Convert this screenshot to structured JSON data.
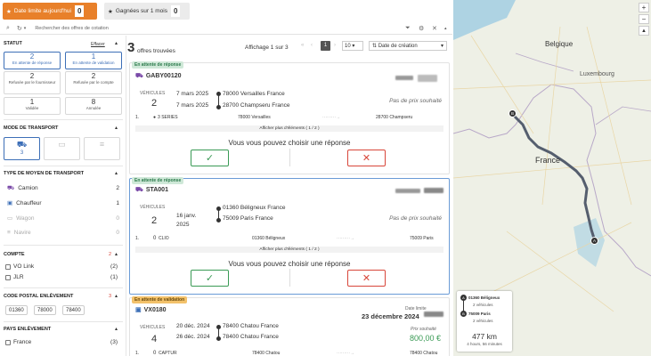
{
  "top_filters": [
    {
      "label": "Date limite aujourd'hui",
      "count": "0",
      "color": "#e8802a"
    },
    {
      "label": "Gagnées sur 1 mois",
      "count": "0",
      "color": "#ebebeb"
    }
  ],
  "search": {
    "placeholder": "Rechercher des offres de cotation"
  },
  "results": {
    "count": "3",
    "label": "offres trouvées",
    "display": "Affichage 1 sur 3",
    "page": "1",
    "per_page": "10",
    "sort": "Date de création"
  },
  "sidebar": {
    "statut": {
      "title": "STATUT",
      "clear": "Effacer",
      "items": [
        {
          "n": "2",
          "label": "En attente de réponse"
        },
        {
          "n": "1",
          "label": "En attente de validation"
        },
        {
          "n": "2",
          "label": "Refusée par le fournisseur"
        },
        {
          "n": "2",
          "label": "Refusée par le compte"
        },
        {
          "n": "1",
          "label": "Validée"
        },
        {
          "n": "8",
          "label": "Annulée"
        }
      ]
    },
    "mode": {
      "title": "MODE DE TRANSPORT",
      "items": [
        {
          "count": "3"
        },
        {
          "count": ""
        },
        {
          "count": ""
        }
      ]
    },
    "moyen": {
      "title": "TYPE DE MOYEN DE TRANSPORT",
      "items": [
        {
          "label": "Camion",
          "count": "2"
        },
        {
          "label": "Chauffeur",
          "count": "1"
        },
        {
          "label": "Wagon",
          "count": "0"
        },
        {
          "label": "Navire",
          "count": "0"
        }
      ]
    },
    "compte": {
      "title": "COMPTE",
      "badge": "2",
      "items": [
        {
          "label": "VO Link",
          "count": "(2)"
        },
        {
          "label": "JLR",
          "count": "(1)"
        }
      ]
    },
    "cp": {
      "title": "CODE POSTAL ENLÈVEMENT",
      "badge": "3",
      "tags": [
        "01360",
        "78000",
        "78400"
      ]
    },
    "pays": {
      "title": "PAYS ENLÈVEMENT",
      "items": [
        {
          "label": "France",
          "count": "(3)"
        }
      ]
    }
  },
  "cards": [
    {
      "badge": "En attente de réponse",
      "ref": "GABY00120",
      "veh_label": "VÉHICULES",
      "veh": "2",
      "date1": "7 mars 2025",
      "date2": "7 mars 2025",
      "from": "78000 Versailles France",
      "to": "28700 Champseru France",
      "price": "Pas de prix souhaité",
      "line_n": "1.",
      "line_model": "3 SERIES",
      "line_from": "78000 Versailles",
      "line_to": "28700 Champseru",
      "more": "Afficher plus d'éléments ( 1 / 2 )",
      "choose": "Vous vous pouvez choisir une réponse"
    },
    {
      "badge": "En attente de réponse",
      "ref": "STA001",
      "veh_label": "VÉHICULES",
      "veh": "2",
      "date1": "16 janv.",
      "date1b": "2025",
      "from": "01360 Béligneux France",
      "to": "75009 Paris France",
      "price": "Pas de prix souhaité",
      "line_n": "1.",
      "line_qty": "0",
      "line_model": "CLIO",
      "line_from": "01360 Béligneux",
      "line_to": "75009 Paris",
      "more": "Afficher plus d'éléments ( 1 / 2 )",
      "choose": "Vous vous pouvez choisir une réponse"
    },
    {
      "badge": "En attente de validation",
      "ref": "VX0180",
      "veh_label": "VÉHICULES",
      "veh": "4",
      "date1": "20 déc. 2024",
      "date2": "26 déc. 2024",
      "from": "78400 Chatou France",
      "to": "78400 Chatou France",
      "deadline_label": "Date limite",
      "deadline": "23 décembre 2024",
      "price_label": "Prix souhaité",
      "price": "800,00 €",
      "line_n": "1.",
      "line_qty": "0",
      "line_model": "CAPTUR",
      "line_from": "78400 Chatou",
      "line_to": "78400 Chatou"
    }
  ],
  "map": {
    "labels": {
      "belgique": "Belgique",
      "luxembourg": "Luxembourg",
      "france": "France"
    },
    "summary": {
      "from": "01360 Béligneux",
      "from_veh": "2 véhicules",
      "to": "75009 Paris",
      "to_veh": "2 véhicules",
      "distance": "477 km",
      "duration": "4 hours, 56 minutes"
    }
  },
  "colors": {
    "accent": "#3d6fb7",
    "ok": "#3a9a55",
    "no": "#d8463a",
    "orange": "#e8802a"
  }
}
